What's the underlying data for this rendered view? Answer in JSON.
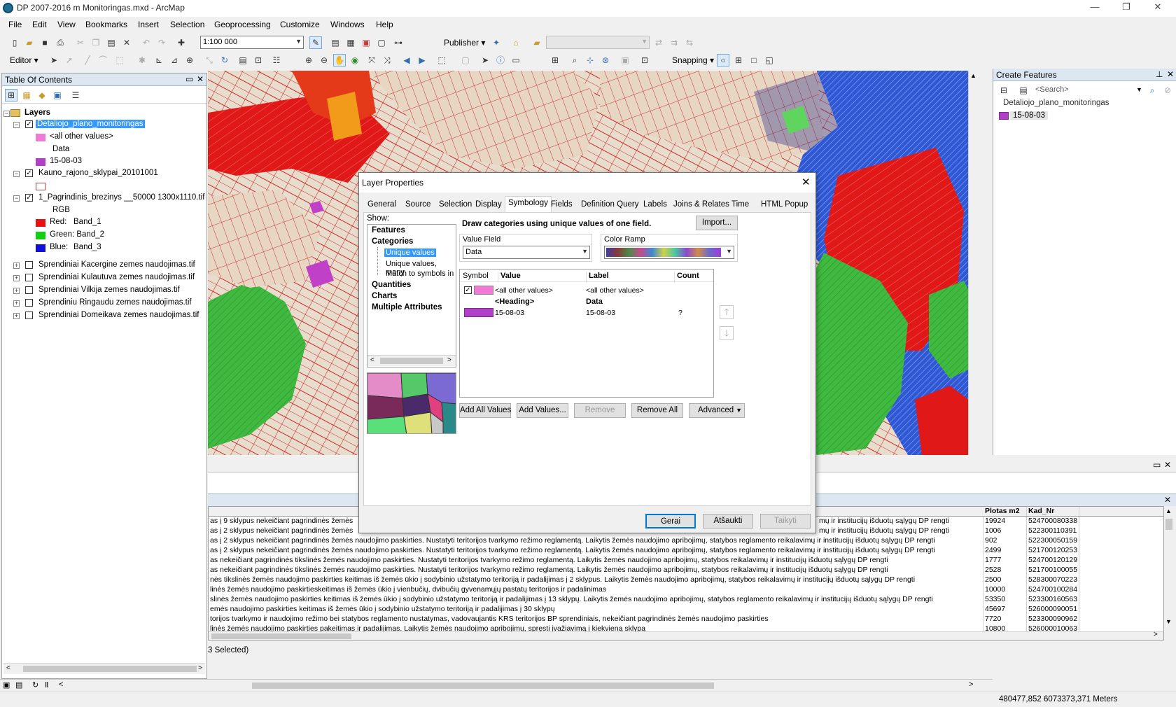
{
  "window": {
    "title": "DP 2007-2016 m Monitoringas.mxd - ArcMap",
    "min": "—",
    "max": "❐",
    "close": "✕"
  },
  "menu": [
    "File",
    "Edit",
    "View",
    "Bookmarks",
    "Insert",
    "Selection",
    "Geoprocessing",
    "Customize",
    "Windows",
    "Help"
  ],
  "toolbar": {
    "scale": "1:100 000",
    "publisher": "Publisher ▾",
    "editor": "Editor ▾",
    "snapping": "Snapping ▾"
  },
  "toc": {
    "title": "Table Of Contents",
    "root": "Layers",
    "layer1": {
      "name": "Detaliojo_plano_monitoringas",
      "other": "<all other values>",
      "heading": "Data",
      "value": "15-08-03",
      "other_color": "#f07ad6",
      "value_color": "#b040c8"
    },
    "layer2": {
      "name": "Kauno_rajono_sklypai_20101001"
    },
    "layer3": {
      "name": "1_Pagrindinis_brezinys __50000 1300x1110.tif",
      "rgb": "RGB",
      "red": "Red:",
      "red_band": "Band_1",
      "green": "Green: Band_2",
      "blue": "Blue:",
      "blue_band": "Band_3"
    },
    "others": [
      "Sprendiniai Kacergine zemes naudojimas.tif",
      "Sprendiniai Kulautuva zemes naudojimas.tif",
      "Sprendiniai Vilkija zemes naudojimas.tif",
      "Sprendiniu Ringaudu zemes naudojimas.tif",
      "Sprendiniai Domeikava zemes naudojimas.tif"
    ]
  },
  "create_features": {
    "title": "Create Features",
    "search": "<Search>",
    "layer": "Detaliojo_plano_monitoringas",
    "item": "15-08-03"
  },
  "dialog": {
    "title": "Layer Properties",
    "tabs": [
      "General",
      "Source",
      "Selection",
      "Display",
      "Symbology",
      "Fields",
      "Definition Query",
      "Labels",
      "Joins & Relates",
      "Time",
      "HTML Popup"
    ],
    "show_label": "Show:",
    "show_items": {
      "features": "Features",
      "categories": "Categories",
      "unique": "Unique values",
      "unique_many": "Unique values, many",
      "match": "Match to symbols in a",
      "quantities": "Quantities",
      "charts": "Charts",
      "multiple": "Multiple Attributes"
    },
    "description": "Draw categories using unique values of one field.",
    "import": "Import...",
    "value_field_label": "Value Field",
    "value_field": "Data",
    "color_ramp_label": "Color Ramp",
    "columns": [
      "Symbol",
      "Value",
      "Label",
      "Count"
    ],
    "rows": [
      {
        "value": "<all other values>",
        "label": "<all other values>",
        "count": ""
      },
      {
        "value": "<Heading>",
        "label": "Data",
        "count": ""
      },
      {
        "value": "15-08-03",
        "label": "15-08-03",
        "count": "?"
      }
    ],
    "buttons": {
      "add_all": "Add All Values",
      "add": "Add Values...",
      "remove": "Remove",
      "remove_all": "Remove All",
      "advanced": "Advanced"
    },
    "ok": "Gerai",
    "cancel": "Atšaukti",
    "apply": "Taikyti"
  },
  "table": {
    "col_area": "Plotas m2",
    "col_kad": "Kad_Nr",
    "rows": [
      {
        "text": "as į 9 sklypus nekeičiant pagrindinės žemės",
        "tail": "mų ir institucijų išduotų sąlygų DP rengti",
        "area": "19924",
        "kad": "524700080338"
      },
      {
        "text": "as į 2 sklypus nekeičiant pagrindinės žemės",
        "tail": "mų ir institucijų išduotų sąlygų DP rengti",
        "area": "1006",
        "kad": "522300110391"
      },
      {
        "text": "as į 2 sklypus nekeičiant pagrindinės žemės naudojimo paskirties. Nustatyti teritorijos tvarkymo režimo reglamentą. Laikytis žemės naudojimo apribojimų, statybos reglamento reikalavimų ir institucijų išduotų sąlygų DP rengti",
        "tail": "",
        "area": "902",
        "kad": "522300050159"
      },
      {
        "text": "as į 2 sklypus nekeičiant pagrindinės žemės naudojimo paskirties. Nustatyti teritorijos tvarkymo režimo reglamentą. Laikytis žemės naudojimo apribojimų, statybos reglamento reikalavimų ir institucijų išduotų sąlygų DP rengti",
        "tail": "",
        "area": "2499",
        "kad": "521700120253"
      },
      {
        "text": "as nekeičiant pagrindinės tikslinės žemės naudojimo paskirties. Nustatyti teritorijos tvarkymo režimo reglamentą. Laikytis žemės naudojimo apribojimų, statybos reikalavimų ir institucijų išduotų sąlygų DP rengti",
        "tail": "",
        "area": "1777",
        "kad": "524700120129"
      },
      {
        "text": "as nekeičiant pagrindinės tikslinės žemės naudojimo paskirties. Nustatyti teritorijos tvarkymo režimo reglamentą. Laikytis žemės naudojimo apribojimų, statybos reikalavimų ir institucijų išduotų sąlygų DP rengti",
        "tail": "",
        "area": "2528",
        "kad": "521700100055"
      },
      {
        "text": "nės tikslinės žemės naudojimo paskirties keitimas iš žemės ūkio į sodybinio užstatymo teritoriją ir padalijimas į 2 sklypus. Laikytis žemės naudojimo apribojimų, statybos reikalavimų ir institucijų išduotų sąlygų DP rengti",
        "tail": "",
        "area": "2500",
        "kad": "528300070223"
      },
      {
        "text": "linės žemės naudojimo paskirtieskeitimas iš žemės ūkio į vienbučių, dvibučių gyvenamųjų pastatų teritorijos ir padalinimas",
        "tail": "",
        "area": "10000",
        "kad": "524700100284"
      },
      {
        "text": "slinės žemės naudojimo paskirties keitimas iš žemės ūkio į sodybinio užstatymo teritoriją ir padalijimas į 13 sklypų. Laikytis žemės naudojimo apribojimų, statybos reglamento reikalavimų ir institucijų išduotų sąlygų DP rengti",
        "tail": "",
        "area": "53350",
        "kad": "523300160563"
      },
      {
        "text": "emės naudojimo paskirties keitimas iš žemės ūkio į sodybinio užstatymo teritoriją ir padalijimas į 30 sklypų",
        "tail": "",
        "area": "45697",
        "kad": "526000090051"
      },
      {
        "text": "torijos tvarkymo ir naudojimo režimo bei statybos reglamento nustatymas, vadovaujantis KRS teritorijos BP sprendiniais, nekeičiant pagrindinės žemės naudojimo paskirties",
        "tail": "",
        "area": "7720",
        "kad": "523300090962"
      },
      {
        "text": "linės žemės naudojimo paskirties pakeitimas ir padalijimas. Laikytis žemės naudojimo apribojimų, spręsti įvažiavimą į kiekvieną sklypą",
        "tail": "",
        "area": "10800",
        "kad": "526000010063"
      }
    ],
    "selected": "3 Selected)"
  },
  "status": {
    "coords": "480477,852  6073373,371 Meters"
  },
  "colors": {
    "map_red": "#e0201a",
    "map_green": "#4cc44a",
    "map_blue": "#2a4fd0",
    "selection": "#3399ff"
  }
}
